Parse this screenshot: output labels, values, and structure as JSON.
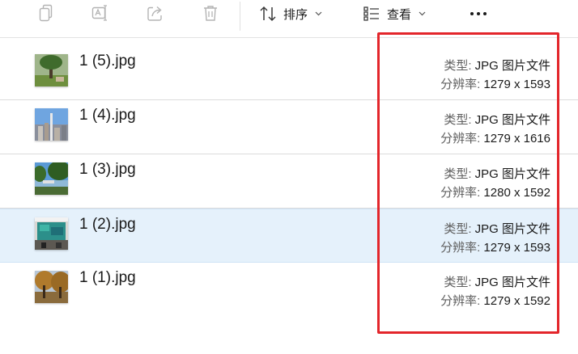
{
  "toolbar": {
    "copy_icon": "copy-icon",
    "rename_icon": "rename-icon",
    "share_icon": "share-icon",
    "delete_icon": "delete-icon",
    "sort_label": "排序",
    "view_label": "查看",
    "more_icon": "more-icon"
  },
  "labels": {
    "type_key": "类型: ",
    "resolution_key": "分辨率: "
  },
  "files": [
    {
      "name": "1 (5).jpg",
      "type": "JPG 图片文件",
      "resolution": "1279 x 1593",
      "thumb": "tree-and-grass",
      "selected": false
    },
    {
      "name": "1 (4).jpg",
      "type": "JPG 图片文件",
      "resolution": "1279 x 1616",
      "thumb": "city-tower",
      "selected": false
    },
    {
      "name": "1 (3).jpg",
      "type": "JPG 图片文件",
      "resolution": "1280 x 1592",
      "thumb": "lake-and-trees",
      "selected": false
    },
    {
      "name": "1 (2).jpg",
      "type": "JPG 图片文件",
      "resolution": "1279 x 1593",
      "thumb": "screen-in-room",
      "selected": true
    },
    {
      "name": "1 (1).jpg",
      "type": "JPG 图片文件",
      "resolution": "1279 x 1592",
      "thumb": "autumn-trees",
      "selected": false
    }
  ],
  "colors": {
    "accent": "#e3262b",
    "selected_row": "#e5f1fb",
    "divider": "#dcdcdc",
    "icon_disabled": "#b3b3b3",
    "icon_active": "#3a3a3a"
  }
}
